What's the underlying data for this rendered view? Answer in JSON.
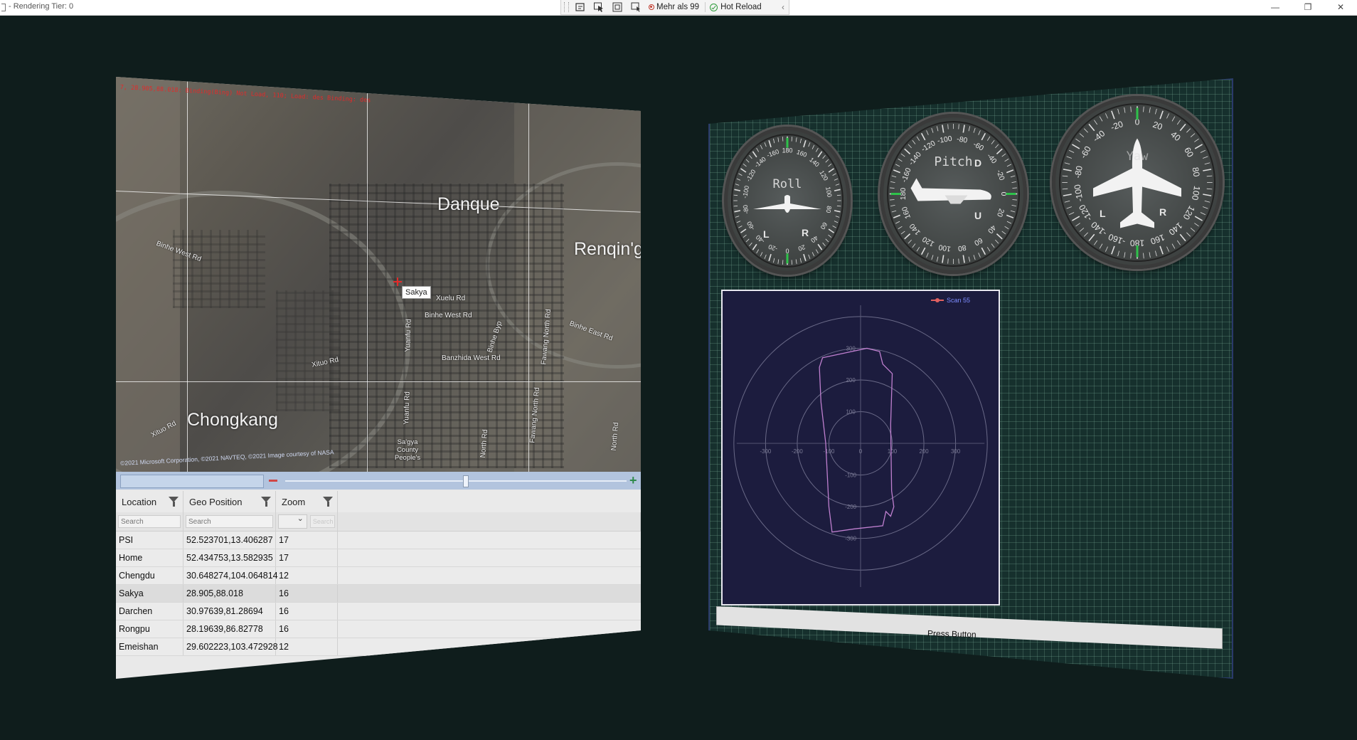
{
  "window": {
    "title": "- Rendering Tier: 0",
    "devtools": {
      "binding_badge": "Mehr als 99",
      "hot_reload": "Hot Reload"
    },
    "controls": [
      "—",
      "❐",
      "✕"
    ]
  },
  "map": {
    "overlay_text": "7, 28.905,88.018: Binding(Bing) Not Load, 110; Load: des Binding: des",
    "copyright": "©2021 Microsoft Corporation, ©2021 NAVTEQ, ©2021 Image courtesy of NASA",
    "place_labels": {
      "danque": "Danque",
      "renqing": "Renqin'g",
      "chongkang": "Chongkang"
    },
    "road_labels": {
      "binhe_west_1": "Binhe West Rd",
      "binhe_west_2": "Binhe West Rd",
      "xuelu": "Xuelu Rd",
      "banzhida": "Banzhida West Rd",
      "binhe_byp": "Binhe Byp",
      "binhe_east": "Binhe East Rd",
      "yuanfu": "Yuanfu Rd",
      "xituo_1": "Xituo Rd",
      "xituo_2": "Xituo Rd",
      "fawang_north": "Fawang North Rd",
      "north_rd": "North Rd",
      "yuanfu_2": "Yuanfu Rd",
      "sakya_county": "Sa'gya County People's"
    },
    "pin_label": "Sakya"
  },
  "table": {
    "columns": [
      "Location",
      "Geo Position",
      "Zoom"
    ],
    "filter_placeholders": [
      "Search",
      "Search"
    ],
    "filter_button": "Search",
    "rows": [
      {
        "location": "PSI",
        "geo": "52.523701,13.406287",
        "zoom": "17"
      },
      {
        "location": "Home",
        "geo": "52.434753,13.582935",
        "zoom": "17"
      },
      {
        "location": "Chengdu",
        "geo": "30.648274,104.064814",
        "zoom": "12"
      },
      {
        "location": "Sakya",
        "geo": "28.905,88.018",
        "zoom": "16"
      },
      {
        "location": "Darchen",
        "geo": "30.97639,81.28694",
        "zoom": "16"
      },
      {
        "location": "Rongpu",
        "geo": "28.19639,86.82778",
        "zoom": "16"
      },
      {
        "location": "Emeishan",
        "geo": "29.602223,103.472928",
        "zoom": "12"
      }
    ]
  },
  "gauges": {
    "roll": {
      "label": "Roll",
      "left": "L",
      "right": "R",
      "ticks": [
        "180",
        "160",
        "140",
        "120",
        "100",
        "80",
        "60",
        "40",
        "20",
        "0",
        "-20",
        "-40",
        "-60",
        "-80",
        "-100",
        "-120",
        "-140",
        "-160"
      ]
    },
    "pitch": {
      "label": "Pitch",
      "up": "U",
      "down": "D",
      "ticks": [
        "0",
        "20",
        "40",
        "60",
        "80",
        "100",
        "120",
        "140",
        "160",
        "180",
        "-160",
        "-140",
        "-120",
        "-100",
        "-80",
        "-60",
        "-40",
        "-20"
      ]
    },
    "yaw": {
      "label": "Yaw",
      "left": "L",
      "right": "R",
      "ticks": [
        "0",
        "20",
        "40",
        "60",
        "80",
        "100",
        "120",
        "140",
        "160",
        "180",
        "-160",
        "-140",
        "-120",
        "-100",
        "-80",
        "-60",
        "-40",
        "-20"
      ]
    }
  },
  "radar": {
    "legend": "Scan 55",
    "x_ticks": [
      "-300",
      "-200",
      "-100",
      "0",
      "100",
      "200",
      "300"
    ],
    "y_ticks": [
      "300",
      "200",
      "100",
      "-100",
      "-200",
      "-300"
    ]
  },
  "button": {
    "label": "Press Button"
  },
  "colors": {
    "background": "#0f1d1c",
    "panel_border": "#2a3a6a",
    "radar_bg": "#1c1c3e",
    "scan": "#c080d0",
    "gauge_green": "#2ec24a"
  }
}
